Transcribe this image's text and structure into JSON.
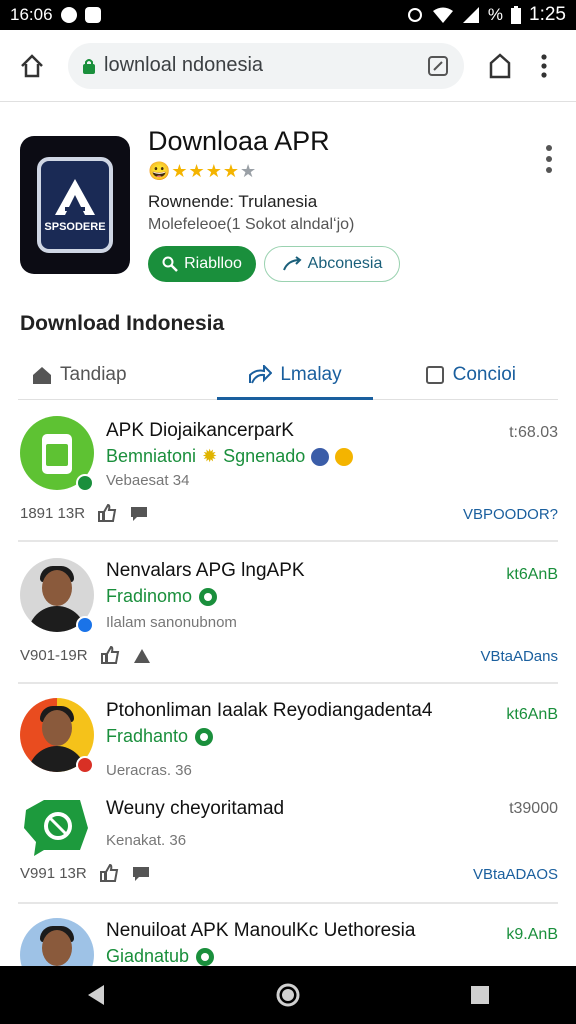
{
  "status_bar": {
    "left_time": "16:06",
    "battery_label": "%",
    "time": "1:25",
    "icons": [
      "whatsapp-icon",
      "notification-icon",
      "alarm-icon",
      "wifi-icon",
      "signal-icon",
      "battery-icon"
    ]
  },
  "browser": {
    "url": "lownloal ndonesia",
    "icons": [
      "home-icon",
      "lock-icon",
      "tabs-icon",
      "bookmark-icon",
      "menu-dots-icon"
    ]
  },
  "app": {
    "title": "Downloaa APR",
    "rating_stars": 4,
    "rating_max": 5,
    "rating_on": "★★★★",
    "rating_off": "★",
    "rating_emoji": "😀",
    "developer": "Rownende: Trulanesia",
    "meta": "Molefeleoe(1 Sokot alndalʻjo)",
    "icon_text": "SPSODERE",
    "install_label": "Riablloo",
    "share_label": "Abconesia"
  },
  "section_title": "Download Indonesia",
  "tabs": [
    {
      "label": "Tandiap"
    },
    {
      "label": "Lmalay"
    },
    {
      "label": "Concioi"
    }
  ],
  "items": [
    {
      "title": "APK DiojaikancerparK",
      "sub": "Bemniatoni",
      "sub2": "Sgnenado",
      "meta": "Vebaesat 34",
      "size": "t:68.03",
      "foot_count": "1891 13R",
      "action": "VBPOODOR?"
    },
    {
      "title": "Nenvalars APG lngAPK",
      "sub": "Fradinomo",
      "meta": "Ilalam sanonubnom",
      "size": "kt6AnB",
      "foot_count": "V901-19R",
      "action": "VBtaADans"
    },
    {
      "title": "Ptohonliman Iaalak Reyodiangadenta4",
      "sub": "Fradhanto",
      "meta": "Ueracras. 36",
      "size": "kt6AnB"
    },
    {
      "title": "Weuny cheyoritamad",
      "meta": "Kenakat. 36",
      "size": "t39000",
      "foot_count": "V991 13R",
      "action": "VBtaADAOS"
    },
    {
      "title": "Nenuiloat APK ManoulKc Uethoresia",
      "sub": "Giadnatub",
      "size": "k9.AnB"
    }
  ],
  "colors": {
    "accent_green": "#1a8f3c",
    "accent_blue": "#1a5f9e",
    "star": "#f4b400"
  }
}
